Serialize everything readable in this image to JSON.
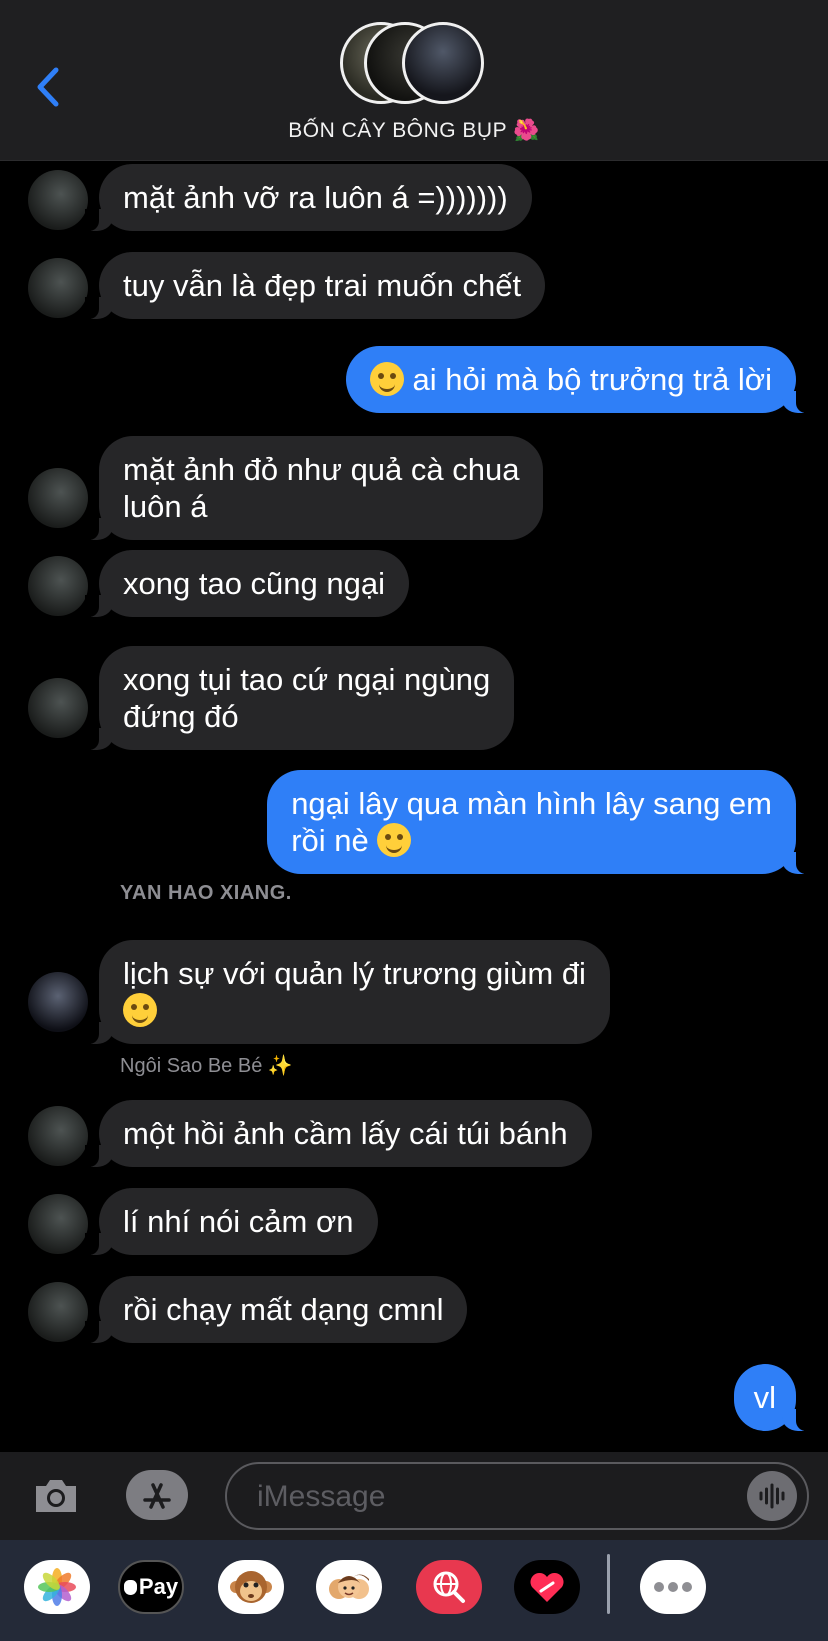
{
  "header": {
    "group_name": "BỐN CÂY BÔNG BỤP",
    "group_emoji": "🌺"
  },
  "messages": [
    {
      "text": "mặt ảnh vỡ ra luôn á =)))))))"
    },
    {
      "text": "tuy vẫn là đẹp trai muốn chết"
    },
    {
      "text": "ai hỏi mà bộ trưởng trả lời"
    },
    {
      "line1": "mặt ảnh đỏ như quả cà chua",
      "line2": "luôn á"
    },
    {
      "text": "xong tao cũng ngại"
    },
    {
      "line1": "xong tụi tao cứ ngại ngùng",
      "line2": "đứng đó"
    },
    {
      "line1": "ngại lây qua màn hình lây sang em",
      "line2": "rồi nè"
    },
    {
      "sender": "YAN HAO XIANG.",
      "line1": "lịch sự với quản lý trương giùm đi"
    },
    {
      "sender": "Ngôi Sao Be Bé",
      "sender_emoji": "✨",
      "text": "một hồi ảnh cầm lấy cái túi bánh"
    },
    {
      "text": "lí nhí nói cảm ơn"
    },
    {
      "text": "rồi chạy mất dạng cmnl"
    },
    {
      "text": "vl"
    }
  ],
  "input": {
    "placeholder": "iMessage"
  },
  "app_drawer": {
    "apple_pay_label": "Pay"
  },
  "colors": {
    "outgoing_bubble": "#2f7ff7",
    "incoming_bubble": "#262628",
    "accent": "#2f7ff7"
  }
}
